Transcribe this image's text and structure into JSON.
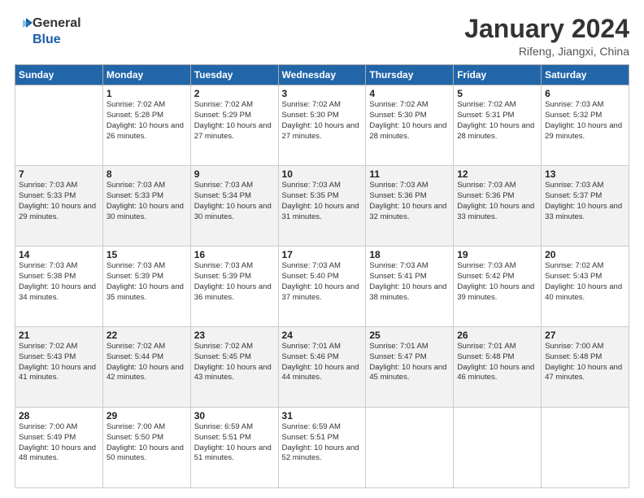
{
  "logo": {
    "line1": "General",
    "line2": "Blue",
    "icon_color": "#1a5fa8"
  },
  "title": "January 2024",
  "subtitle": "Rifeng, Jiangxi, China",
  "days_of_week": [
    "Sunday",
    "Monday",
    "Tuesday",
    "Wednesday",
    "Thursday",
    "Friday",
    "Saturday"
  ],
  "weeks": [
    [
      null,
      {
        "day": 1,
        "sunrise": "7:02 AM",
        "sunset": "5:28 PM",
        "daylight": "10 hours and 26 minutes."
      },
      {
        "day": 2,
        "sunrise": "7:02 AM",
        "sunset": "5:29 PM",
        "daylight": "10 hours and 27 minutes."
      },
      {
        "day": 3,
        "sunrise": "7:02 AM",
        "sunset": "5:30 PM",
        "daylight": "10 hours and 27 minutes."
      },
      {
        "day": 4,
        "sunrise": "7:02 AM",
        "sunset": "5:30 PM",
        "daylight": "10 hours and 28 minutes."
      },
      {
        "day": 5,
        "sunrise": "7:02 AM",
        "sunset": "5:31 PM",
        "daylight": "10 hours and 28 minutes."
      },
      {
        "day": 6,
        "sunrise": "7:03 AM",
        "sunset": "5:32 PM",
        "daylight": "10 hours and 29 minutes."
      }
    ],
    [
      {
        "day": 7,
        "sunrise": "7:03 AM",
        "sunset": "5:33 PM",
        "daylight": "10 hours and 29 minutes."
      },
      {
        "day": 8,
        "sunrise": "7:03 AM",
        "sunset": "5:33 PM",
        "daylight": "10 hours and 30 minutes."
      },
      {
        "day": 9,
        "sunrise": "7:03 AM",
        "sunset": "5:34 PM",
        "daylight": "10 hours and 30 minutes."
      },
      {
        "day": 10,
        "sunrise": "7:03 AM",
        "sunset": "5:35 PM",
        "daylight": "10 hours and 31 minutes."
      },
      {
        "day": 11,
        "sunrise": "7:03 AM",
        "sunset": "5:36 PM",
        "daylight": "10 hours and 32 minutes."
      },
      {
        "day": 12,
        "sunrise": "7:03 AM",
        "sunset": "5:36 PM",
        "daylight": "10 hours and 33 minutes."
      },
      {
        "day": 13,
        "sunrise": "7:03 AM",
        "sunset": "5:37 PM",
        "daylight": "10 hours and 33 minutes."
      }
    ],
    [
      {
        "day": 14,
        "sunrise": "7:03 AM",
        "sunset": "5:38 PM",
        "daylight": "10 hours and 34 minutes."
      },
      {
        "day": 15,
        "sunrise": "7:03 AM",
        "sunset": "5:39 PM",
        "daylight": "10 hours and 35 minutes."
      },
      {
        "day": 16,
        "sunrise": "7:03 AM",
        "sunset": "5:39 PM",
        "daylight": "10 hours and 36 minutes."
      },
      {
        "day": 17,
        "sunrise": "7:03 AM",
        "sunset": "5:40 PM",
        "daylight": "10 hours and 37 minutes."
      },
      {
        "day": 18,
        "sunrise": "7:03 AM",
        "sunset": "5:41 PM",
        "daylight": "10 hours and 38 minutes."
      },
      {
        "day": 19,
        "sunrise": "7:03 AM",
        "sunset": "5:42 PM",
        "daylight": "10 hours and 39 minutes."
      },
      {
        "day": 20,
        "sunrise": "7:02 AM",
        "sunset": "5:43 PM",
        "daylight": "10 hours and 40 minutes."
      }
    ],
    [
      {
        "day": 21,
        "sunrise": "7:02 AM",
        "sunset": "5:43 PM",
        "daylight": "10 hours and 41 minutes."
      },
      {
        "day": 22,
        "sunrise": "7:02 AM",
        "sunset": "5:44 PM",
        "daylight": "10 hours and 42 minutes."
      },
      {
        "day": 23,
        "sunrise": "7:02 AM",
        "sunset": "5:45 PM",
        "daylight": "10 hours and 43 minutes."
      },
      {
        "day": 24,
        "sunrise": "7:01 AM",
        "sunset": "5:46 PM",
        "daylight": "10 hours and 44 minutes."
      },
      {
        "day": 25,
        "sunrise": "7:01 AM",
        "sunset": "5:47 PM",
        "daylight": "10 hours and 45 minutes."
      },
      {
        "day": 26,
        "sunrise": "7:01 AM",
        "sunset": "5:48 PM",
        "daylight": "10 hours and 46 minutes."
      },
      {
        "day": 27,
        "sunrise": "7:00 AM",
        "sunset": "5:48 PM",
        "daylight": "10 hours and 47 minutes."
      }
    ],
    [
      {
        "day": 28,
        "sunrise": "7:00 AM",
        "sunset": "5:49 PM",
        "daylight": "10 hours and 48 minutes."
      },
      {
        "day": 29,
        "sunrise": "7:00 AM",
        "sunset": "5:50 PM",
        "daylight": "10 hours and 50 minutes."
      },
      {
        "day": 30,
        "sunrise": "6:59 AM",
        "sunset": "5:51 PM",
        "daylight": "10 hours and 51 minutes."
      },
      {
        "day": 31,
        "sunrise": "6:59 AM",
        "sunset": "5:51 PM",
        "daylight": "10 hours and 52 minutes."
      },
      null,
      null,
      null
    ]
  ]
}
